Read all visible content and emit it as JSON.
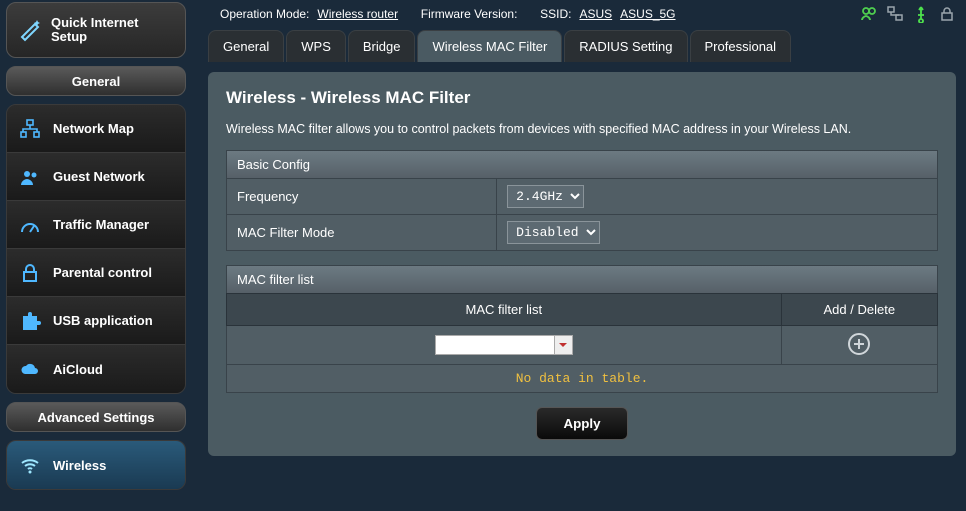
{
  "header": {
    "op_mode_label": "Operation Mode:",
    "op_mode_value": "Wireless router",
    "fw_label": "Firmware Version:",
    "ssid_label": "SSID:",
    "ssid_a": "ASUS",
    "ssid_b": "ASUS_5G"
  },
  "qis": {
    "title": "Quick Internet Setup"
  },
  "menu_general_head": "General",
  "menu_general": [
    {
      "label": "Network Map"
    },
    {
      "label": "Guest Network"
    },
    {
      "label": "Traffic Manager"
    },
    {
      "label": "Parental control"
    },
    {
      "label": "USB application"
    },
    {
      "label": "AiCloud"
    }
  ],
  "menu_adv_head": "Advanced Settings",
  "menu_adv": [
    {
      "label": "Wireless",
      "active": true
    }
  ],
  "tabs": [
    {
      "label": "General"
    },
    {
      "label": "WPS"
    },
    {
      "label": "Bridge"
    },
    {
      "label": "Wireless MAC Filter",
      "active": true
    },
    {
      "label": "RADIUS Setting"
    },
    {
      "label": "Professional"
    }
  ],
  "page": {
    "title": "Wireless - Wireless MAC Filter",
    "desc": "Wireless MAC filter allows you to control packets from devices with specified MAC address in your Wireless LAN.",
    "basic_config_head": "Basic Config",
    "freq_label": "Frequency",
    "freq_value": "2.4GHz",
    "mode_label": "MAC Filter Mode",
    "mode_value": "Disabled",
    "filter_list_head": "MAC filter list",
    "col_list": "MAC filter list",
    "col_adddel": "Add / Delete",
    "combo_value": "",
    "nodata": "No data in table.",
    "apply": "Apply"
  }
}
